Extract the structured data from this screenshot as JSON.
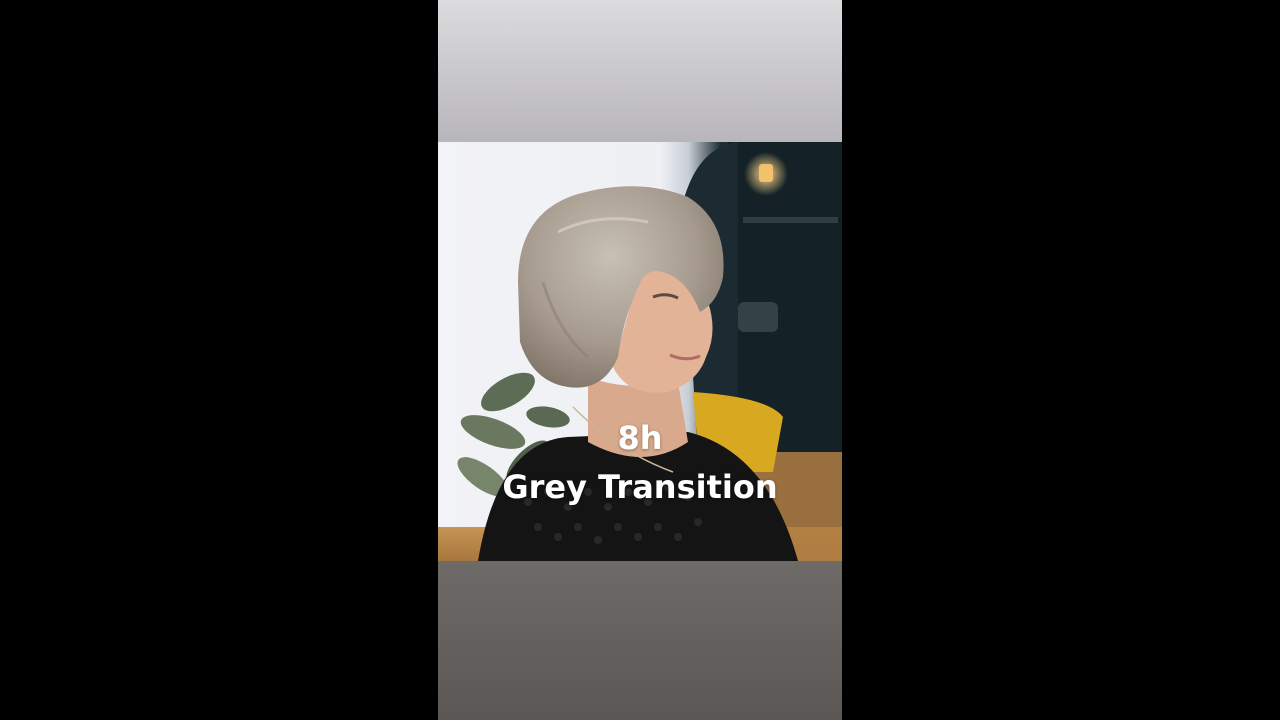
{
  "overlay": {
    "line1": "8h",
    "line2": "Grey Transition"
  },
  "colors": {
    "letterbox": "#000000",
    "top_band": "#cfcdd1",
    "bottom_band": "#66625f",
    "caption_text": "#ffffff"
  },
  "icons": {
    "pendant_light": "lamp-icon"
  }
}
